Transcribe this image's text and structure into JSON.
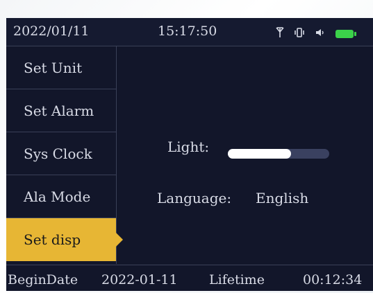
{
  "status": {
    "date": "2022/01/11",
    "time": "15:17:50",
    "icons": [
      "antenna-icon",
      "vibrate-icon",
      "speaker-icon",
      "battery-icon"
    ],
    "battery_color": "#3bd24a"
  },
  "menu": {
    "items": [
      {
        "label": "Set Unit"
      },
      {
        "label": "Set Alarm"
      },
      {
        "label": "Sys Clock"
      },
      {
        "label": "Ala Mode"
      },
      {
        "label": "Set disp"
      }
    ],
    "active_index": 4,
    "accent": "#e7b634"
  },
  "display": {
    "light_label": "Light:",
    "light_level_fraction": 0.62,
    "language_label": "Language:",
    "language_value": "English"
  },
  "footer": {
    "begin_label": "BeginDate",
    "begin_value": "2022-01-11",
    "lifetime_label": "Lifetime",
    "lifetime_value": "00:12:34"
  }
}
